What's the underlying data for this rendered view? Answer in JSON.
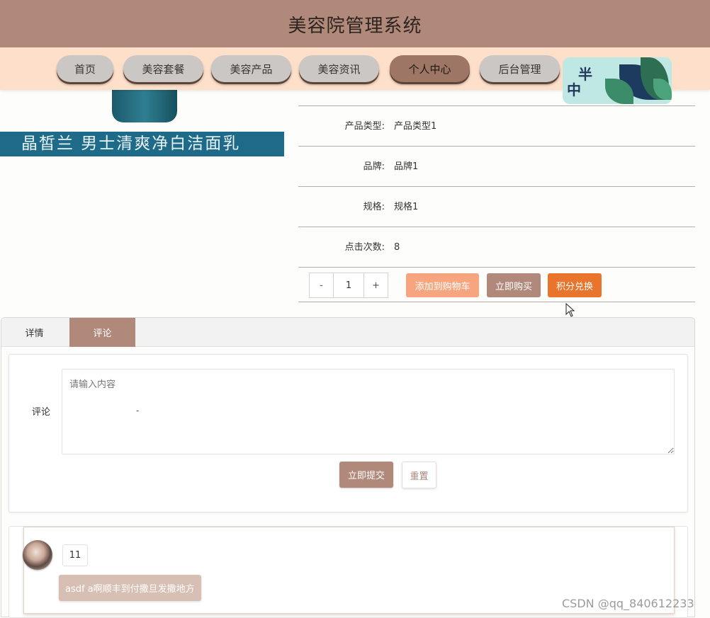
{
  "header": {
    "title": "美容院管理系统"
  },
  "nav": {
    "items": [
      {
        "label": "首页"
      },
      {
        "label": "美容套餐"
      },
      {
        "label": "美容产品"
      },
      {
        "label": "美容资讯"
      },
      {
        "label": "个人中心",
        "active": true
      },
      {
        "label": "后台管理"
      }
    ],
    "decoration_text": [
      "半",
      "中"
    ]
  },
  "product": {
    "banner_text": "晶皙兰  男士清爽净白洁面乳",
    "fields": [
      {
        "label": "产品类型:",
        "value": "产品类型1"
      },
      {
        "label": "品牌:",
        "value": "品牌1"
      },
      {
        "label": "规格:",
        "value": "规格1"
      },
      {
        "label": "点击次数:",
        "value": "8"
      }
    ],
    "quantity": {
      "minus": "-",
      "value": "1",
      "plus": "+"
    },
    "actions": {
      "add_to_cart": "添加到购物车",
      "buy_now": "立即购买",
      "points_exchange": "积分兑换"
    }
  },
  "tabs": [
    {
      "label": "详情",
      "active": false
    },
    {
      "label": "评论",
      "active": true
    }
  ],
  "comment_form": {
    "label": "评论",
    "placeholder": "请输入内容",
    "inner_mark": "-",
    "submit_label": "立即提交",
    "reset_label": "重置"
  },
  "comments": [
    {
      "user": "11",
      "text": "asdf a啊顺丰到付撒旦发撒地方"
    }
  ],
  "watermark": "CSDN @qq_840612233",
  "colors": {
    "brand": "#b1897a",
    "nav_bg": "#fddfca",
    "add_to_cart": "#f7a57e",
    "buy_now": "#b1897a",
    "points_exchange": "#e9742b"
  }
}
